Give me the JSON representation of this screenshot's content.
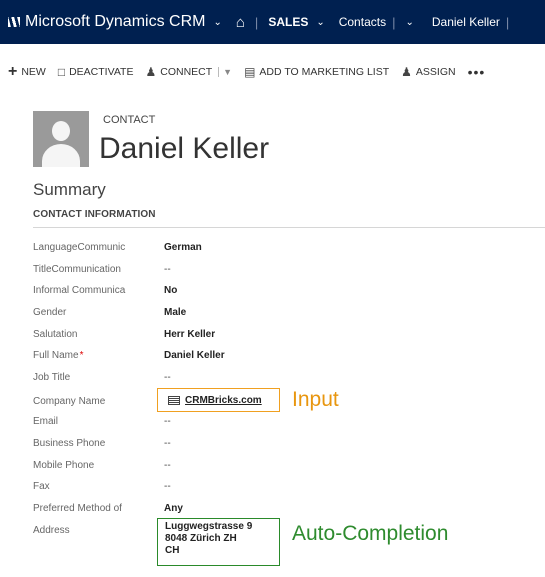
{
  "nav": {
    "app_title": "Microsoft Dynamics CRM",
    "area": "SALES",
    "entity": "Contacts",
    "record": "Daniel Keller",
    "chevron": "⌄"
  },
  "commands": {
    "new": "NEW",
    "deactivate": "DEACTIVATE",
    "connect": "CONNECT",
    "add_to_marketing_list": "ADD TO MARKETING LIST",
    "assign": "ASSIGN",
    "more": "•••"
  },
  "header": {
    "entity_type": "CONTACT",
    "name": "Daniel Keller"
  },
  "summary_title": "Summary",
  "section_title": "CONTACT INFORMATION",
  "fields": [
    {
      "label": "LanguageCommunic",
      "value": "German",
      "empty": false
    },
    {
      "label": "TitleCommunication",
      "value": "--",
      "empty": true
    },
    {
      "label": "Informal Communica",
      "value": "No",
      "empty": false
    },
    {
      "label": "Gender",
      "value": "Male",
      "empty": false
    },
    {
      "label": "Salutation",
      "value": "Herr Keller",
      "empty": false
    },
    {
      "label": "Full Name",
      "value": "Daniel Keller",
      "empty": false,
      "required": true
    },
    {
      "label": "Job Title",
      "value": "--",
      "empty": true
    },
    {
      "label": "Company Name",
      "value": "CRMBricks.com",
      "empty": false
    },
    {
      "label": "Email",
      "value": "--",
      "empty": true
    },
    {
      "label": "Business Phone",
      "value": "--",
      "empty": true
    },
    {
      "label": "Mobile Phone",
      "value": "--",
      "empty": true
    },
    {
      "label": "Fax",
      "value": "--",
      "empty": true
    },
    {
      "label": "Preferred Method of",
      "value": "Any",
      "empty": false
    },
    {
      "label": "Address",
      "value": "",
      "empty": false
    }
  ],
  "address_lines": [
    "Luggwegstrasse 9",
    "8048 Zürich ZH",
    "CH"
  ],
  "callouts": {
    "input": "Input",
    "auto_completion": "Auto-Completion"
  },
  "colors": {
    "navbar": "#002050",
    "input_callout": "#e8960f",
    "auto_completion_callout": "#2e8b2e",
    "required": "#dd0000"
  }
}
